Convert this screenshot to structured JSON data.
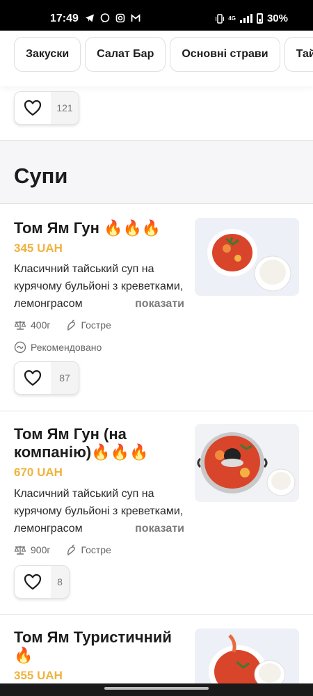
{
  "status_bar": {
    "time": "17:49",
    "network": "4G",
    "battery": "30%",
    "app_icons": [
      "telegram-icon",
      "viber-icon",
      "instagram-icon",
      "gmail-icon"
    ]
  },
  "categories": [
    "Закуски",
    "Салат Бар",
    "Основні страви",
    "Тайсь"
  ],
  "prev_item": {
    "likes": "121"
  },
  "section": {
    "title": "Супи"
  },
  "items": [
    {
      "name": "Том Ям Гун 🔥🔥🔥",
      "price": "345 UAH",
      "description": "Класичний тайський суп на курячому бульйоні з креветками, лемонграсом",
      "more": "показати",
      "weight": "400г",
      "tag": "Гостре",
      "recommended": "Рекомендовано",
      "likes": "87"
    },
    {
      "name": "Том Ям Гун (на компанію)🔥🔥🔥",
      "price": "670 UAH",
      "description": "Класичний тайський суп на курячому бульйоні з креветками, лемонграсом",
      "more": "показати",
      "weight": "900г",
      "tag": "Гостре",
      "likes": "8"
    },
    {
      "name": "Том Ям Туристичний 🔥",
      "price": "355 UAH"
    }
  ],
  "colors": {
    "price": "#efb33f",
    "section_bg": "#f6f5f8",
    "soup_red": "#d9452b"
  }
}
